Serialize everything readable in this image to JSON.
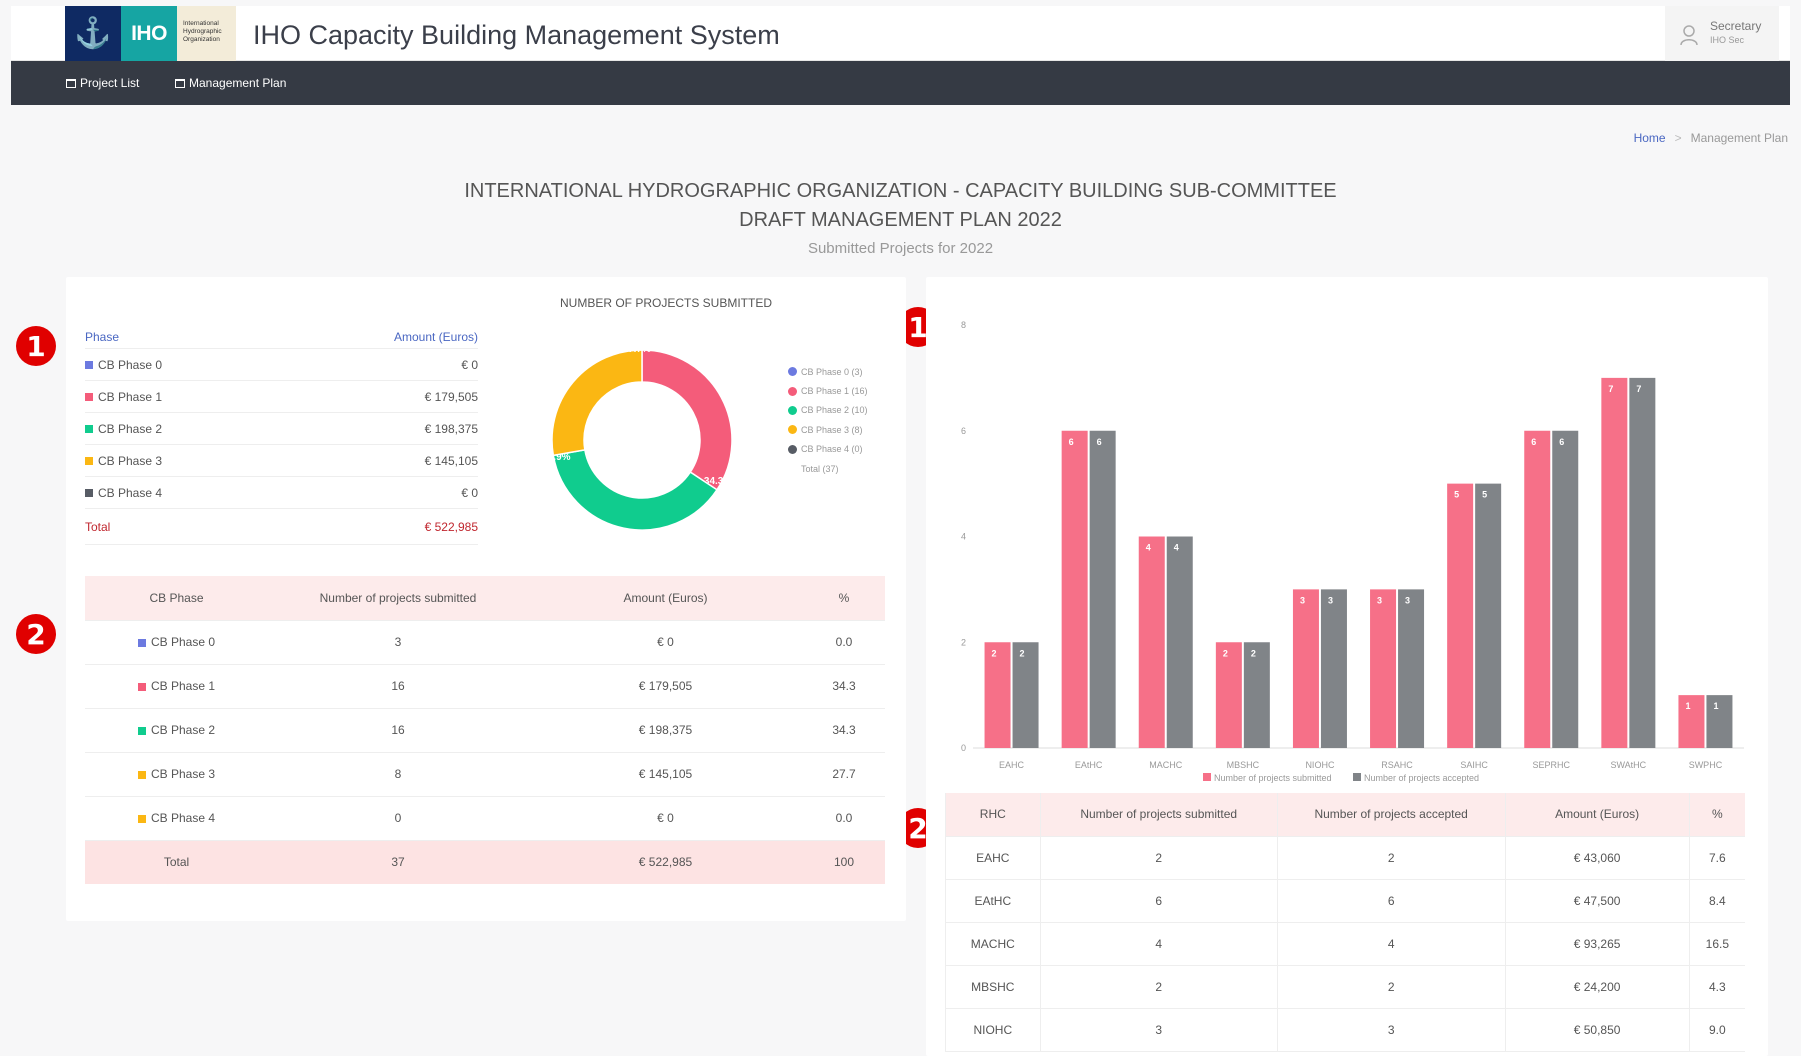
{
  "header": {
    "logo_text": "IHO",
    "logo_org": [
      "International",
      "Hydrographic",
      "Organization"
    ],
    "app_title": "IHO Capacity Building Management System",
    "user_name": "Secretary",
    "user_role": "IHO Sec"
  },
  "nav": {
    "items": [
      {
        "label": "Project List"
      },
      {
        "label": "Management Plan"
      }
    ]
  },
  "breadcrumb": {
    "home": "Home",
    "sep": ">",
    "current": "Management Plan"
  },
  "page": {
    "title1": "INTERNATIONAL HYDROGRAPHIC ORGANIZATION - CAPACITY BUILDING SUB-COMMITTEE",
    "title2": "DRAFT MANAGEMENT PLAN 2022",
    "subtitle": "Submitted Projects for 2022"
  },
  "markers": {
    "one": "1",
    "two": "2"
  },
  "colors": {
    "phase0": "#6c7ae0",
    "phase1": "#f45c7a",
    "phase2": "#10cc8e",
    "phase3": "#fbb713",
    "phase4": "#575c65",
    "submitted": "#f67088",
    "accepted": "#808488",
    "total_red": "#c0262e"
  },
  "summary": {
    "header": {
      "phase": "Phase",
      "amount": "Amount (Euros)"
    },
    "rows": [
      {
        "label": "CB Phase 0",
        "amount": "€ 0",
        "color": "#6c7ae0"
      },
      {
        "label": "CB Phase 1",
        "amount": "€ 179,505",
        "color": "#f45c7a"
      },
      {
        "label": "CB Phase 2",
        "amount": "€ 198,375",
        "color": "#10cc8e"
      },
      {
        "label": "CB Phase 3",
        "amount": "€ 145,105",
        "color": "#fbb713"
      },
      {
        "label": "CB Phase 4",
        "amount": "€ 0",
        "color": "#575c65"
      }
    ],
    "total_label": "Total",
    "total_amount": "€ 522,985"
  },
  "donut": {
    "title": "NUMBER OF PROJECTS SUBMITTED",
    "legend": [
      {
        "label": "CB Phase 0 (3)",
        "color": "#6c7ae0"
      },
      {
        "label": "CB Phase 1 (16)",
        "color": "#f45c7a"
      },
      {
        "label": "CB Phase 2 (10)",
        "color": "#10cc8e"
      },
      {
        "label": "CB Phase 3 (8)",
        "color": "#fbb713"
      },
      {
        "label": "CB Phase 4 (0)",
        "color": "#575c65"
      }
    ],
    "legend_total": "Total (37)"
  },
  "phase_table": {
    "headers": [
      "CB Phase",
      "Number of projects submitted",
      "Amount (Euros)",
      "%"
    ],
    "rows": [
      {
        "phase": "CB Phase 0",
        "count": "3",
        "amount": "€ 0",
        "pct": "0.0",
        "color": "#6c7ae0"
      },
      {
        "phase": "CB Phase 1",
        "count": "16",
        "amount": "€ 179,505",
        "pct": "34.3",
        "color": "#f45c7a"
      },
      {
        "phase": "CB Phase 2",
        "count": "16",
        "amount": "€ 198,375",
        "pct": "34.3",
        "color": "#10cc8e"
      },
      {
        "phase": "CB Phase 3",
        "count": "8",
        "amount": "€ 145,105",
        "pct": "27.7",
        "color": "#fbb713"
      },
      {
        "phase": "CB Phase 4",
        "count": "0",
        "amount": "€ 0",
        "pct": "0.0",
        "color": "#fbb713"
      }
    ],
    "total": {
      "label": "Total",
      "count": "37",
      "amount": "€ 522,985",
      "pct": "100"
    }
  },
  "rhc_table": {
    "headers": [
      "RHC",
      "Number of projects submitted",
      "Number of projects accepted",
      "Amount (Euros)",
      "%"
    ],
    "rows": [
      {
        "rhc": "EAHC",
        "submitted": "2",
        "accepted": "2",
        "amount": "€ 43,060",
        "pct": "7.6"
      },
      {
        "rhc": "EAtHC",
        "submitted": "6",
        "accepted": "6",
        "amount": "€ 47,500",
        "pct": "8.4"
      },
      {
        "rhc": "MACHC",
        "submitted": "4",
        "accepted": "4",
        "amount": "€ 93,265",
        "pct": "16.5"
      },
      {
        "rhc": "MBSHC",
        "submitted": "2",
        "accepted": "2",
        "amount": "€ 24,200",
        "pct": "4.3"
      },
      {
        "rhc": "NIOHC",
        "submitted": "3",
        "accepted": "3",
        "amount": "€ 50,850",
        "pct": "9.0"
      }
    ]
  },
  "chart_data": [
    {
      "type": "pie",
      "title": "NUMBER OF PROJECTS SUBMITTED",
      "categories": [
        "CB Phase 0",
        "CB Phase 1",
        "CB Phase 2",
        "CB Phase 3",
        "CB Phase 4"
      ],
      "values": [
        0,
        34.3,
        37.9,
        27.7,
        0
      ],
      "slice_labels": [
        "",
        "34.3%",
        "37.9%",
        "27.7%",
        ""
      ],
      "colors": [
        "#6c7ae0",
        "#f45c7a",
        "#10cc8e",
        "#fbb713",
        "#575c65"
      ],
      "legend": "right"
    },
    {
      "type": "bar",
      "categories": [
        "EAHC",
        "EAtHC",
        "MACHC",
        "MBSHC",
        "NIOHC",
        "RSAHC",
        "SAIHC",
        "SEPRHC",
        "SWAtHC",
        "SWPHC"
      ],
      "series": [
        {
          "name": "Number of projects submitted",
          "values": [
            2,
            6,
            4,
            2,
            3,
            3,
            5,
            6,
            7,
            1
          ],
          "color": "#f67088"
        },
        {
          "name": "Number of projects accepted",
          "values": [
            2,
            6,
            4,
            2,
            3,
            3,
            5,
            6,
            7,
            1
          ],
          "color": "#808488"
        }
      ],
      "ylim": [
        0,
        8
      ],
      "yticks": [
        0,
        2,
        4,
        6,
        8
      ],
      "legend": "bottom",
      "grid": false
    }
  ]
}
